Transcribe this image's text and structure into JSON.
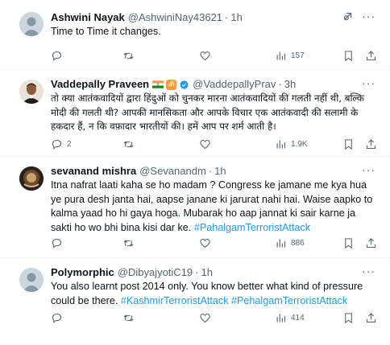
{
  "tweets": [
    {
      "name": "Ashwini Nayak",
      "handle": "@AshwiniNay43621",
      "time": "1h",
      "text": "Time to Time it changes.",
      "replies": "",
      "retweets": "",
      "likes": "",
      "views": "157"
    },
    {
      "name": "Vaddepally Praveen",
      "handle": "@VaddepallyPrav",
      "time": "3h",
      "text": "तो क्या आतंकवादियों द्वारा हिंदुओं को चुनकर मारना आतंकवादियों की गलती नहीं थी, बल्कि मोदी की गलती थी? आपकी मानसिकता और आपके विचार एक आतंकवादी की सलामी के हकदार हैं, न कि वफ़ादार भारतीयों की। हमें आप पर शर्म आती है।",
      "replies": "2",
      "retweets": "",
      "likes": "",
      "views": "1.9K",
      "om_symbol": "ॐ"
    },
    {
      "name": "sevanand mishra",
      "handle": "@Sevanandm",
      "time": "1h",
      "text": "Itna nafrat laati kaha se ho madam ? Congress ke jamane me kya hua ye pura desh janta hai, aapse janane ki jarurat nahi hai. Waise aapko to kalma yaad ho hi gaya hoga. Mubarak ho aap jannat ki sair karne ja sakti ho wo bhi bina kisi dar ke.",
      "hashtags": [
        "#PahalgamTerroristAttack"
      ],
      "replies": "",
      "retweets": "",
      "likes": "",
      "views": "886"
    },
    {
      "name": "Polymorphic",
      "handle": "@DibyajyotiC19",
      "time": "1h",
      "text": "You also learnt post 2014 only. You know better what kind of pressure could be there.",
      "hashtags": [
        "#KashmirTerroristAttack",
        "#PehalgamTerroristAttack"
      ],
      "replies": "",
      "retweets": "",
      "likes": "",
      "views": "414"
    }
  ],
  "separator": "·",
  "more_label": "···",
  "colors": {
    "accent": "#1d9bf0",
    "muted": "#536471",
    "text": "#0f1419",
    "divider": "#eff3f4"
  }
}
